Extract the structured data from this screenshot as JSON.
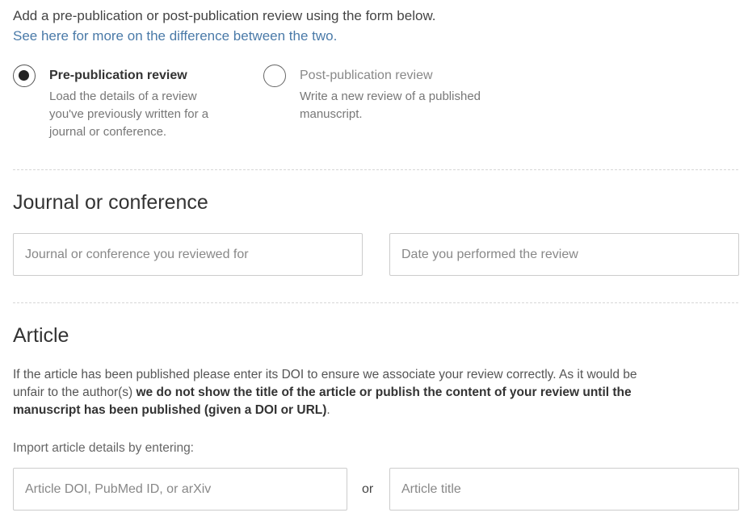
{
  "intro": {
    "text": "Add a pre-publication or post-publication review using the form below.",
    "link": "See here for more on the difference between the two."
  },
  "review_type": {
    "selected": "pre",
    "pre": {
      "title": "Pre-publication review",
      "desc_line1": "Load the details of a review",
      "desc_line2": "you've previously written for a",
      "desc_line3": "journal or conference."
    },
    "post": {
      "title": "Post-publication review",
      "desc_line1": "Write a new review of a published",
      "desc_line2": "manuscript."
    }
  },
  "journal_section": {
    "heading": "Journal or conference",
    "journal_placeholder": "Journal or conference you reviewed for",
    "date_placeholder": "Date you performed the review"
  },
  "article_section": {
    "heading": "Article",
    "note_plain_1": "If the article has been published please enter its DOI to ensure we associate your review correctly. As it would be unfair to the author(s) ",
    "note_bold": "we do not show the title of the article or publish the content of your review until the manuscript has been published (given a DOI or URL)",
    "note_plain_2": ".",
    "import_label": "Import article details by entering:",
    "doi_placeholder": "Article DOI, PubMed ID, or arXiv",
    "or_label": "or",
    "title_placeholder": "Article title"
  },
  "colors": {
    "link": "#4a7aa8",
    "border": "#cccccc",
    "divider": "#d6d6d6"
  }
}
